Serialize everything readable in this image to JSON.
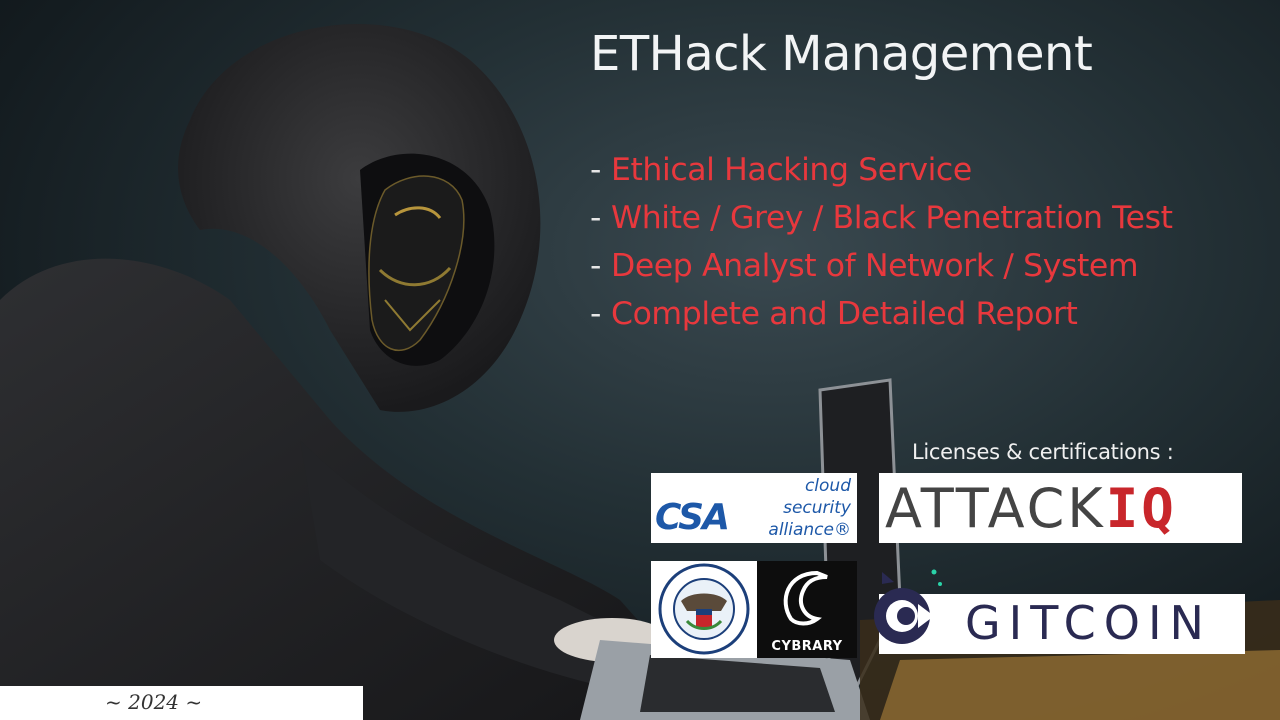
{
  "title": "ETHack Management",
  "services": [
    {
      "dash": "-",
      "label": "Ethical Hacking Service"
    },
    {
      "dash": "-",
      "label": "White / Grey / Black Penetration Test"
    },
    {
      "dash": "-",
      "label": "Deep Analyst of Network / System"
    },
    {
      "dash": "-",
      "label": "Complete and Detailed Report"
    }
  ],
  "certifications": {
    "heading": "Licenses & certifications :",
    "logos": {
      "csa": {
        "mark": "CSA",
        "line1": "cloud",
        "line2": "security",
        "line3": "alliance®"
      },
      "attackiq": {
        "part1": "ATTACK",
        "part2": "IQ"
      },
      "dhs": {
        "seal_text": "U.S. DEPARTMENT OF HOMELAND SECURITY"
      },
      "cybrary": {
        "label": "CYBRARY"
      },
      "gitcoin": {
        "label": "GITCOIN"
      }
    }
  },
  "footer": {
    "year": "~ 2024 ~"
  },
  "colors": {
    "accent_red": "#e8383d",
    "title_white": "#f2f4f5",
    "background": "#1d282c"
  }
}
